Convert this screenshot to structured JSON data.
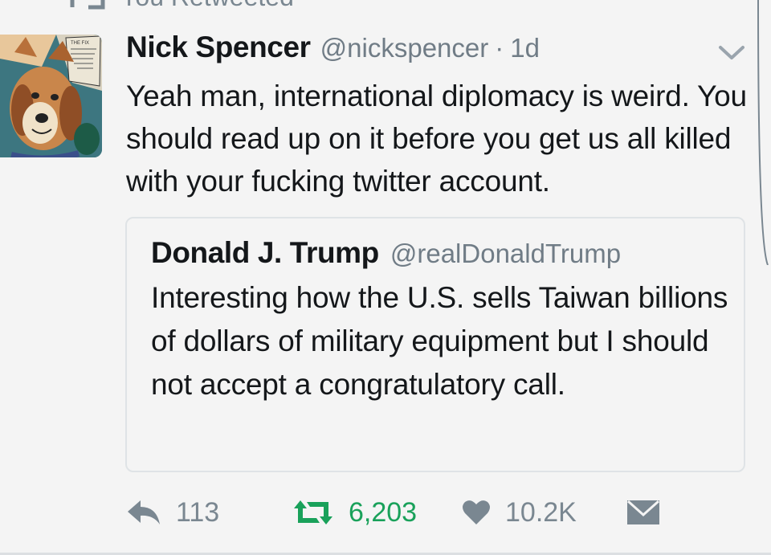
{
  "context": {
    "label": "You Retweeted",
    "icon": "retweet-icon"
  },
  "tweet": {
    "display_name": "Nick Spencer",
    "handle": "@nickspencer",
    "separator": "·",
    "time": "1d",
    "text": "Yeah man, international diplomacy is weird. You should read up on it before you get us all killed with your fucking twitter account.",
    "avatar_icon": "dog-comic-avatar",
    "menu_icon": "chevron-down-icon"
  },
  "quoted_tweet": {
    "display_name": "Donald J. Trump",
    "handle": "@realDonaldTrump",
    "text": "Interesting how the U.S. sells Taiwan billions of dollars of military equipment but I should not accept a congratulatory call."
  },
  "actions": {
    "reply_count": "113",
    "retweet_count": "6,203",
    "like_count": "10.2K",
    "reply_icon": "reply-icon",
    "retweet_icon": "retweet-icon",
    "like_icon": "heart-icon",
    "dm_icon": "envelope-icon"
  },
  "colors": {
    "retweeted_green": "#19a15a",
    "muted_gray": "#7a8791",
    "text_dark": "#14171a",
    "background": "#f4f4f4",
    "border": "#dfe3e6"
  }
}
